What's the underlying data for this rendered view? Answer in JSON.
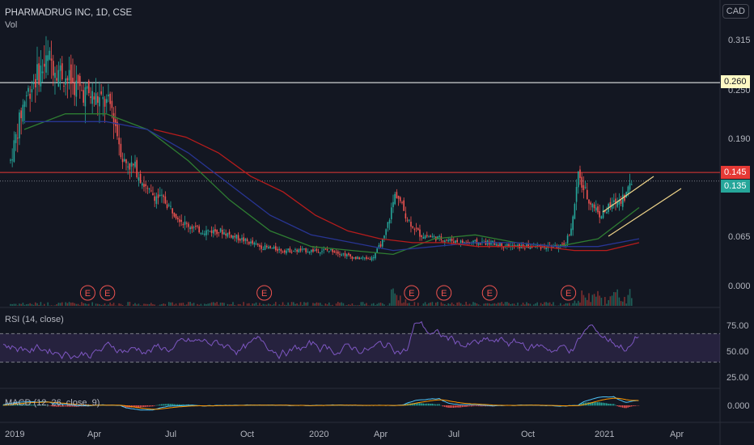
{
  "header": {
    "title": "PHARMADRUG INC, 1D, CSE",
    "volume_label": "Vol",
    "currency": "CAD"
  },
  "rsi": {
    "label": "RSI (14, close)",
    "ticks": [
      "75.00",
      "50.00",
      "25.00"
    ]
  },
  "macd": {
    "label": "MACD (12, 26, close, 9)",
    "ticks": [
      "0.000"
    ]
  },
  "price_axis": {
    "ticks": [
      "0.315",
      "0.250",
      "0.190",
      "0.065",
      "0.000"
    ]
  },
  "price_tags": [
    {
      "value": "0.260",
      "bg": "#fff9c4",
      "fg": "#131722"
    },
    {
      "value": "0.145",
      "bg": "#e53935",
      "fg": "#ffffff"
    },
    {
      "value": "0.135",
      "bg": "#26a69a",
      "fg": "#ffffff"
    }
  ],
  "x_axis": {
    "ticks": [
      "2019",
      "Apr",
      "Jul",
      "Oct",
      "2020",
      "Apr",
      "Jul",
      "Oct",
      "2021",
      "Apr"
    ]
  },
  "earnings_marker": "E",
  "colors": {
    "up": "#26a69a",
    "down": "#ef5350",
    "ma_short": "#2e7d32",
    "ma_mid": "#283593",
    "ma_long": "#b71c1c",
    "rsi": "#7e57c2",
    "hline_260": "#ffffff",
    "hline_145": "#e53935",
    "channel": "#f0d58a",
    "macd": "#4fc3f7",
    "signal": "#ff9800"
  },
  "chart_data": {
    "type": "candlestick",
    "title": "PHARMADRUG INC, 1D, CSE",
    "currency": "CAD",
    "x_range": [
      "2019-01-01",
      "2021-04-30"
    ],
    "y_range": [
      0.0,
      0.33
    ],
    "close_series": [
      {
        "date": "2019-01-02",
        "close": 0.16
      },
      {
        "date": "2019-01-20",
        "close": 0.24
      },
      {
        "date": "2019-02-05",
        "close": 0.27
      },
      {
        "date": "2019-02-20",
        "close": 0.29
      },
      {
        "date": "2019-03-10",
        "close": 0.27
      },
      {
        "date": "2019-04-01",
        "close": 0.25
      },
      {
        "date": "2019-04-20",
        "close": 0.24
      },
      {
        "date": "2019-05-10",
        "close": 0.23
      },
      {
        "date": "2019-05-25",
        "close": 0.16
      },
      {
        "date": "2019-06-10",
        "close": 0.15
      },
      {
        "date": "2019-06-25",
        "close": 0.12
      },
      {
        "date": "2019-07-15",
        "close": 0.11
      },
      {
        "date": "2019-08-10",
        "close": 0.08
      },
      {
        "date": "2019-09-01",
        "close": 0.07
      },
      {
        "date": "2019-09-25",
        "close": 0.07
      },
      {
        "date": "2019-10-20",
        "close": 0.06
      },
      {
        "date": "2019-11-15",
        "close": 0.05
      },
      {
        "date": "2019-12-15",
        "close": 0.045
      },
      {
        "date": "2020-01-15",
        "close": 0.045
      },
      {
        "date": "2020-02-15",
        "close": 0.045
      },
      {
        "date": "2020-03-15",
        "close": 0.035
      },
      {
        "date": "2020-04-05",
        "close": 0.035
      },
      {
        "date": "2020-04-20",
        "close": 0.06
      },
      {
        "date": "2020-05-05",
        "close": 0.12
      },
      {
        "date": "2020-05-20",
        "close": 0.085
      },
      {
        "date": "2020-06-05",
        "close": 0.065
      },
      {
        "date": "2020-07-01",
        "close": 0.06
      },
      {
        "date": "2020-08-01",
        "close": 0.055
      },
      {
        "date": "2020-09-01",
        "close": 0.055
      },
      {
        "date": "2020-10-01",
        "close": 0.05
      },
      {
        "date": "2020-11-01",
        "close": 0.05
      },
      {
        "date": "2020-12-05",
        "close": 0.05
      },
      {
        "date": "2020-12-15",
        "close": 0.08
      },
      {
        "date": "2020-12-22",
        "close": 0.14
      },
      {
        "date": "2021-01-05",
        "close": 0.11
      },
      {
        "date": "2021-01-20",
        "close": 0.09
      },
      {
        "date": "2021-02-05",
        "close": 0.105
      },
      {
        "date": "2021-02-20",
        "close": 0.115
      },
      {
        "date": "2021-03-01",
        "close": 0.135
      }
    ],
    "moving_averages": [
      {
        "name": "MA short",
        "values": [
          0.2,
          0.22,
          0.22,
          0.2,
          0.16,
          0.11,
          0.07,
          0.05,
          0.045,
          0.04,
          0.06,
          0.065,
          0.055,
          0.05,
          0.06,
          0.1
        ]
      },
      {
        "name": "MA mid",
        "values": [
          0.21,
          0.21,
          0.21,
          0.2,
          0.17,
          0.13,
          0.09,
          0.065,
          0.055,
          0.045,
          0.05,
          0.055,
          0.055,
          0.05,
          0.05,
          0.06
        ]
      },
      {
        "name": "MA long",
        "values": [
          0.2,
          0.19,
          0.17,
          0.14,
          0.12,
          0.09,
          0.07,
          0.06,
          0.055,
          0.055,
          0.05,
          0.05,
          0.05,
          0.045,
          0.045,
          0.055
        ]
      }
    ],
    "horizontal_levels": [
      0.26,
      0.145
    ],
    "last_price": 0.135,
    "rsi_range": [
      0,
      100
    ],
    "rsi_levels": [
      70,
      30
    ],
    "earnings_dates": [
      "2019-04-10",
      "2019-05-05",
      "2019-11-20",
      "2020-05-25",
      "2020-07-05",
      "2020-09-01",
      "2020-12-10"
    ]
  }
}
